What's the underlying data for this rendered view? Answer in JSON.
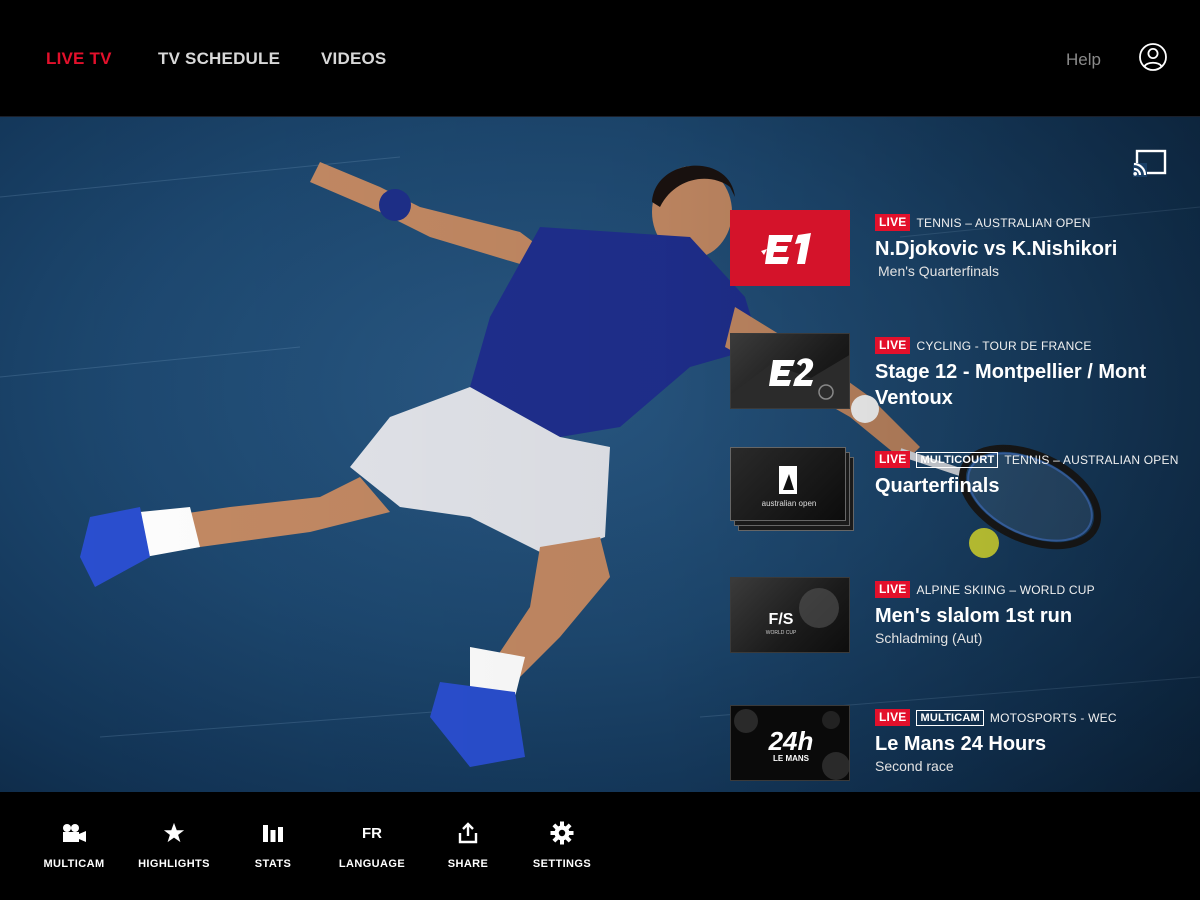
{
  "nav": {
    "tabs": [
      {
        "label": "LIVE TV",
        "active": true
      },
      {
        "label": "TV SCHEDULE",
        "active": false
      },
      {
        "label": "VIDEOS",
        "active": false
      }
    ],
    "help_label": "Help",
    "profile_icon": "user-circle-icon"
  },
  "hero": {
    "cast_icon": "cast-icon"
  },
  "channels": [
    {
      "thumb_label": "E1",
      "live": "LIVE",
      "category": "TENNIS – AUSTRALIAN OPEN",
      "title": "N.Djokovic vs K.Nishikori",
      "subtitle": "Men's Quarterfinals"
    },
    {
      "thumb_label": "E2",
      "live": "LIVE",
      "category": "CYCLING -  TOUR DE FRANCE",
      "title": "Stage 12 - Montpellier / Mont Ventoux",
      "subtitle": ""
    },
    {
      "thumb_label": "australian open",
      "live": "LIVE",
      "badge": "MULTICOURT",
      "category": "TENNIS – AUSTRALIAN OPEN",
      "title": "Quarterfinals",
      "subtitle": ""
    },
    {
      "thumb_label": "WORLD CUP",
      "thumb_logo": "F/S",
      "live": "LIVE",
      "category": "ALPINE SKIING – WORLD CUP",
      "title": "Men's slalom 1st run",
      "subtitle": "Schladming (Aut)"
    },
    {
      "thumb_label": "24h",
      "thumb_sub": "LE MANS",
      "live": "LIVE",
      "badge": "MULTICAM",
      "category": "MOTOSPORTS - WEC",
      "title": "Le Mans 24 Hours",
      "subtitle": "Second race"
    }
  ],
  "toolbar": {
    "items": [
      {
        "label": "MULTICAM",
        "icon": "video-camera-icon"
      },
      {
        "label": "HIGHLIGHTS",
        "icon": "star-icon"
      },
      {
        "label": "STATS",
        "icon": "bar-chart-icon"
      },
      {
        "label": "LANGUAGE",
        "icon_text": "FR"
      },
      {
        "label": "SHARE",
        "icon": "share-icon"
      },
      {
        "label": "SETTINGS",
        "icon": "gear-icon"
      }
    ]
  },
  "colors": {
    "accent": "#e3102b",
    "background": "#000000",
    "hero_blue": "#1d4870"
  }
}
